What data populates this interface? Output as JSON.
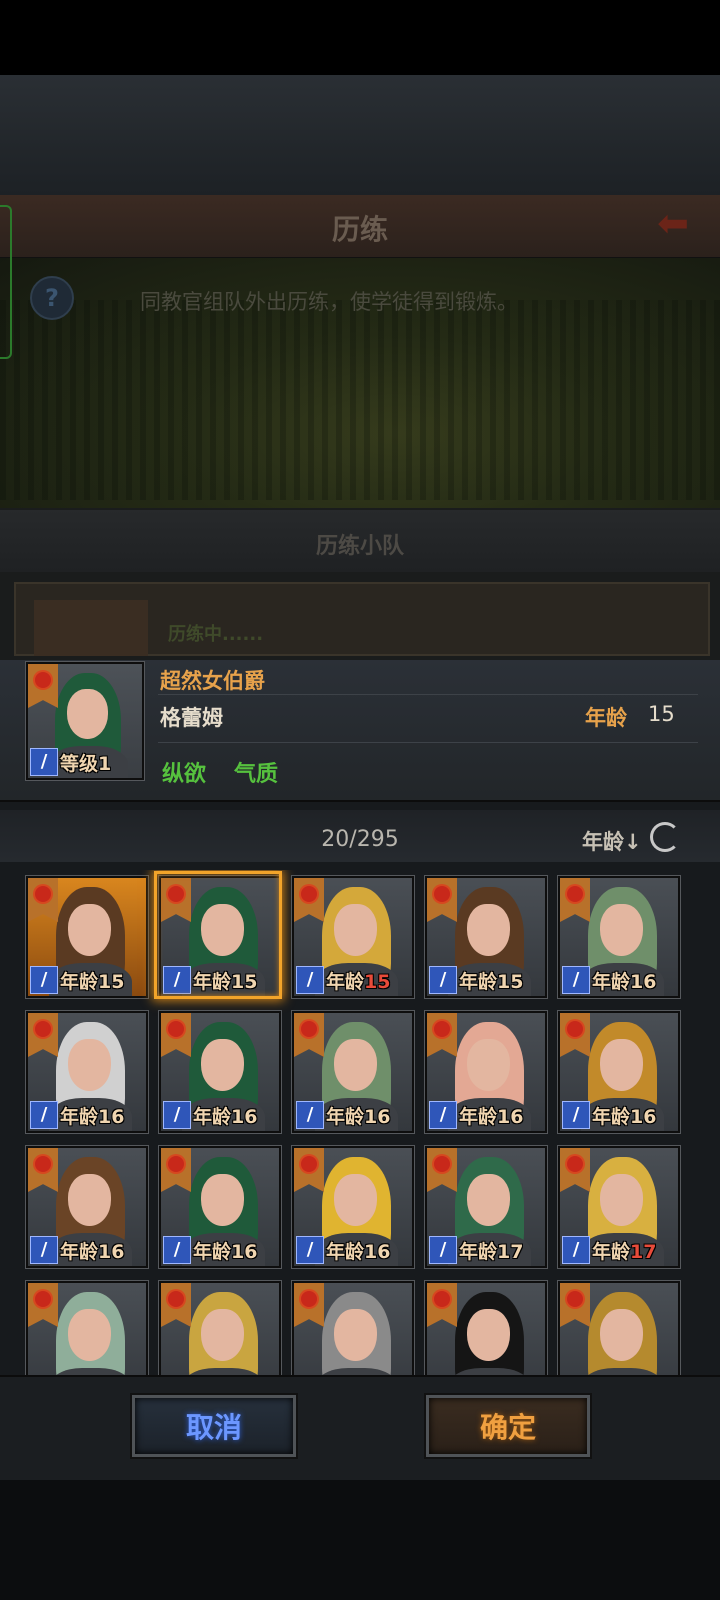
{
  "background": {
    "title": "历练",
    "description": "同教官组队外出历练，使学徒得到锻炼。",
    "squad_title": "历练小队",
    "squad_status": "历练中......"
  },
  "hero": {
    "title": "超然女伯爵",
    "name": "格蕾姆",
    "age_label": "年龄",
    "age_value": "15",
    "level_text": "等级1",
    "traits": [
      "纵欲",
      "气质"
    ]
  },
  "roster": {
    "count": "20/295",
    "sort_label": "年龄↓"
  },
  "cells": [
    {
      "label": "年龄",
      "age": "15",
      "hair": "#5a3a22",
      "bg": "#c07418",
      "red": false
    },
    {
      "label": "年龄",
      "age": "15",
      "hair": "#1f5a3a",
      "bg": "#4a4f55",
      "red": false
    },
    {
      "label": "年龄",
      "age": "15",
      "hair": "#d4a83a",
      "bg": "#4a4f55",
      "red": true
    },
    {
      "label": "年龄",
      "age": "15",
      "hair": "#5a3a22",
      "bg": "#4a4f55",
      "red": false
    },
    {
      "label": "年龄",
      "age": "16",
      "hair": "#6f8f6a",
      "bg": "#4a4f55",
      "red": false
    },
    {
      "label": "年龄",
      "age": "16",
      "hair": "#d0d0d0",
      "bg": "#4a4f55",
      "red": false
    },
    {
      "label": "年龄",
      "age": "16",
      "hair": "#1f5a3a",
      "bg": "#4a4f55",
      "red": false
    },
    {
      "label": "年龄",
      "age": "16",
      "hair": "#6f8f6a",
      "bg": "#4a4f55",
      "red": false
    },
    {
      "label": "年龄",
      "age": "16",
      "hair": "#e3a894",
      "bg": "#4a4f55",
      "red": false
    },
    {
      "label": "年龄",
      "age": "16",
      "hair": "#c28a2a",
      "bg": "#4a4f55",
      "red": false
    },
    {
      "label": "年龄",
      "age": "16",
      "hair": "#6a4426",
      "bg": "#4a4f55",
      "red": false
    },
    {
      "label": "年龄",
      "age": "16",
      "hair": "#1f5a3a",
      "bg": "#4a4f55",
      "red": false
    },
    {
      "label": "年龄",
      "age": "16",
      "hair": "#e0b430",
      "bg": "#4a4f55",
      "red": false
    },
    {
      "label": "年龄",
      "age": "17",
      "hair": "#2f6a4a",
      "bg": "#4a4f55",
      "red": false
    },
    {
      "label": "年龄",
      "age": "17",
      "hair": "#d8b040",
      "bg": "#4a4f55",
      "red": true
    },
    {
      "label": "",
      "age": "",
      "hair": "#8fae9a",
      "bg": "#4a4f55",
      "red": false
    },
    {
      "label": "",
      "age": "",
      "hair": "#c9a540",
      "bg": "#4a4f55",
      "red": false
    },
    {
      "label": "",
      "age": "",
      "hair": "#8a8a8a",
      "bg": "#4a4f55",
      "red": false
    },
    {
      "label": "",
      "age": "",
      "hair": "#151515",
      "bg": "#4a4f55",
      "red": false
    },
    {
      "label": "",
      "age": "",
      "hair": "#b58a2e",
      "bg": "#4a4f55",
      "red": false
    }
  ],
  "selected_index": 1,
  "buttons": {
    "cancel": "取消",
    "confirm": "确定"
  },
  "colors": {
    "accent_gold": "#e7a24b",
    "trait_green": "#56c23e",
    "selection_orange": "#f2a42a"
  }
}
